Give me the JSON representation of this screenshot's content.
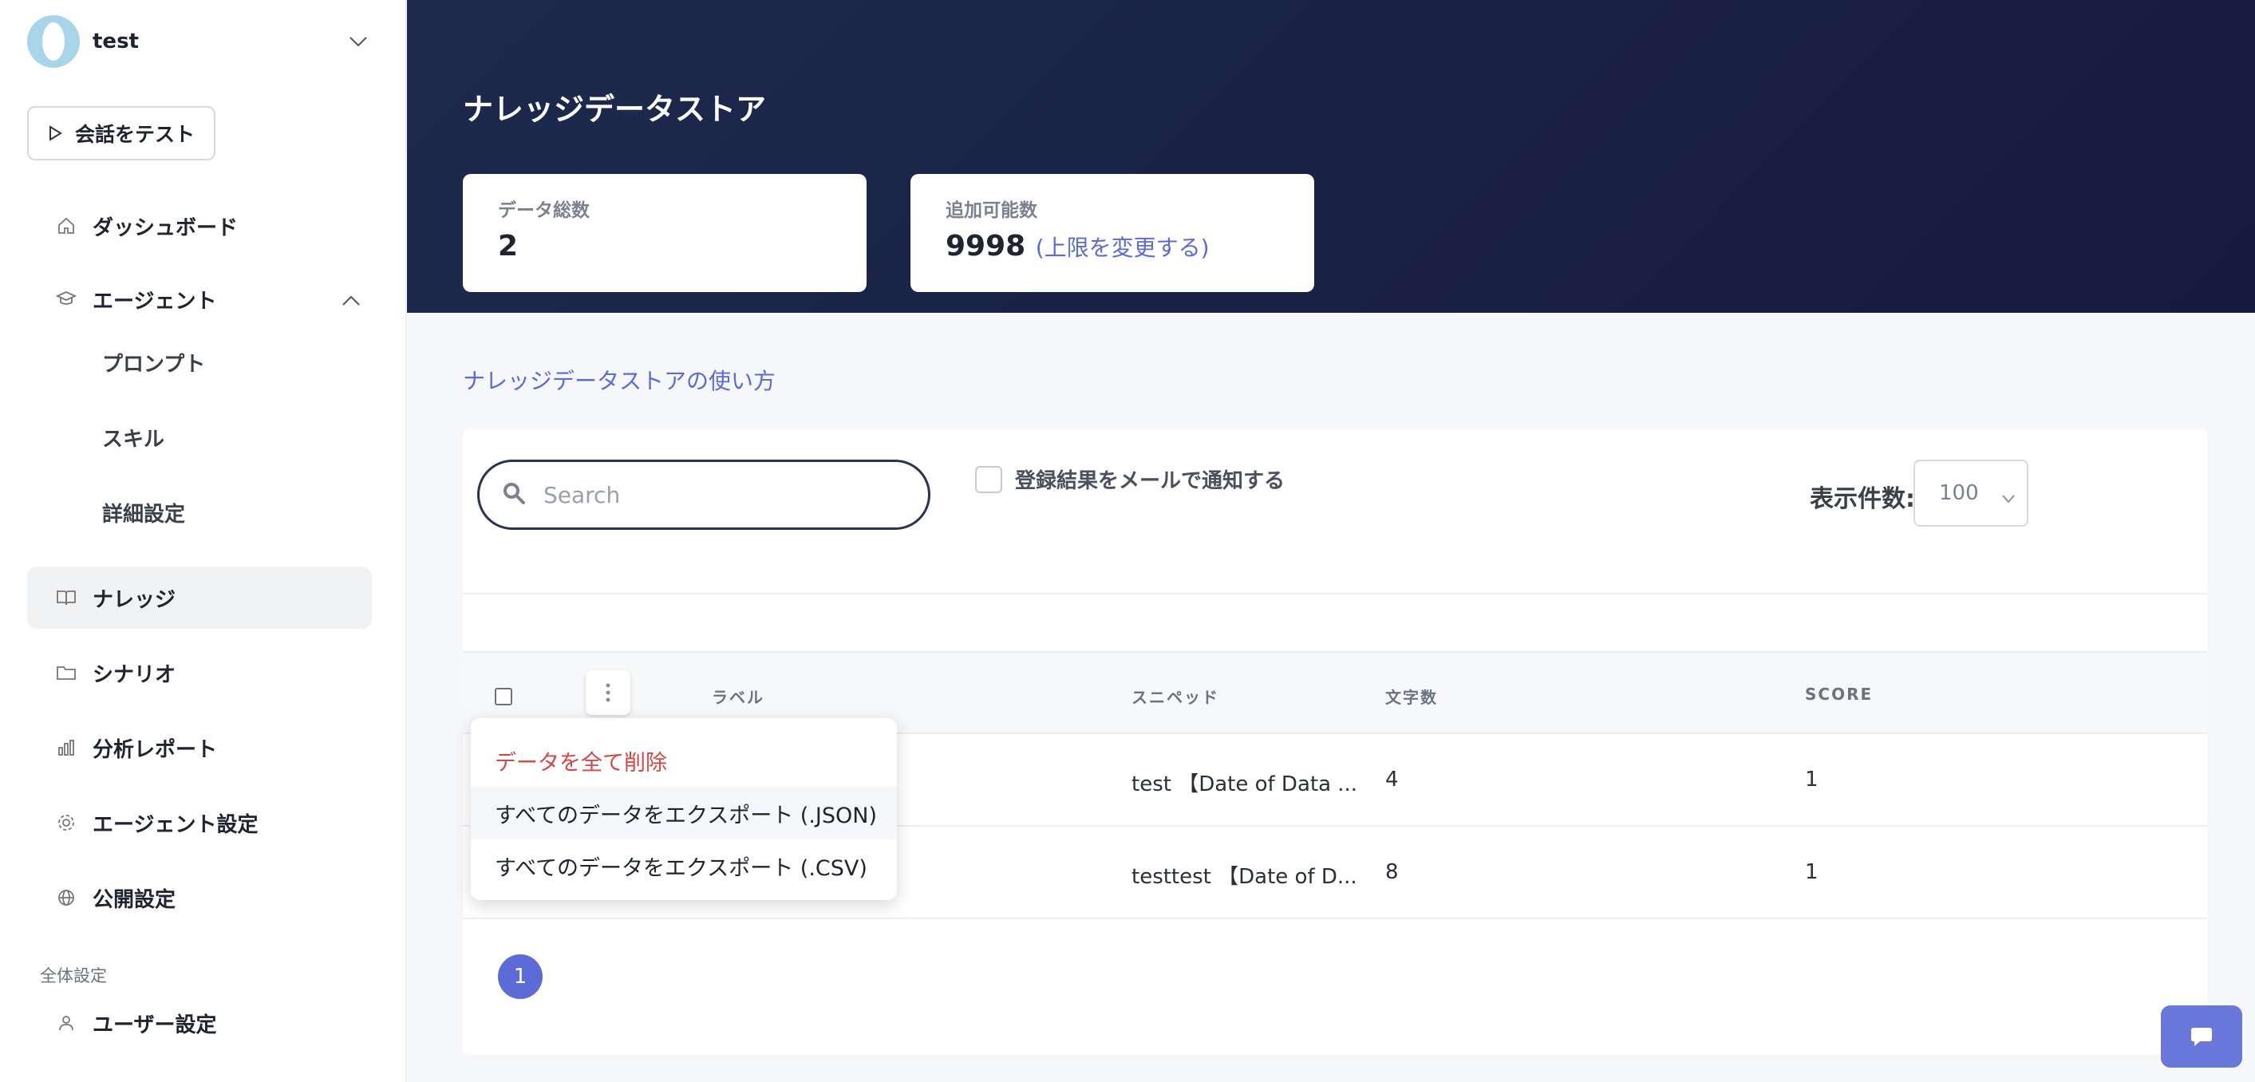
{
  "sidebar": {
    "workspace_name": "test",
    "test_button_label": "会話をテスト",
    "items": {
      "dashboard": "ダッシュボード",
      "agent": "エージェント",
      "prompt": "プロンプト",
      "skill": "スキル",
      "advanced": "詳細設定",
      "knowledge": "ナレッジ",
      "scenario": "シナリオ",
      "report": "分析レポート",
      "agent_settings": "エージェント設定",
      "publish": "公開設定"
    },
    "section_label": "全体設定",
    "user_settings": "ユーザー設定"
  },
  "header": {
    "title": "ナレッジデータストア",
    "stats": {
      "total_label": "データ総数",
      "total_value": "2",
      "available_label": "追加可能数",
      "available_value": "9998",
      "change_limit_link": "(上限を変更する)"
    }
  },
  "main": {
    "howto_link": "ナレッジデータストアの使い方",
    "search": {
      "placeholder": "Search",
      "value": ""
    },
    "notify_label": "登録結果をメールで通知する",
    "per_page_label": "表示件数:",
    "per_page_value": "100",
    "columns": [
      "ラベル",
      "スニペッド",
      "文字数",
      "SCORE"
    ],
    "rows": [
      {
        "snippet": "test 【Date of Data ...",
        "chars": "4",
        "score": "1"
      },
      {
        "snippet": "testtest 【Date of D...",
        "chars": "8",
        "score": "1"
      }
    ],
    "page": "1"
  },
  "menu": {
    "delete_all": "データを全て削除",
    "export_json": "すべてのデータをエクスポート (.JSON)",
    "export_csv": "すべてのデータをエクスポート (.CSV)"
  },
  "colors": {
    "hero_bg": "#1d2a4e",
    "accent": "#5c6bd6",
    "danger": "#d64545"
  }
}
